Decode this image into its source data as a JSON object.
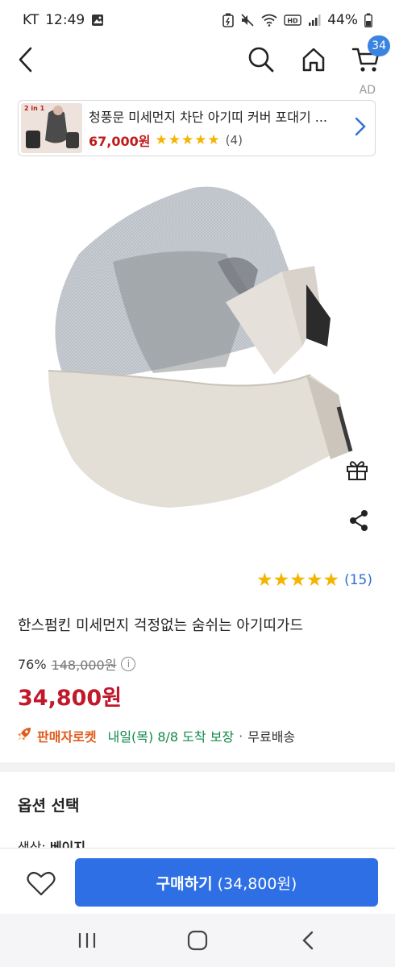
{
  "status_bar": {
    "carrier": "KT",
    "time": "12:49",
    "battery": "44%",
    "icons": [
      "gallery-icon",
      "battery-saver-icon",
      "mute-icon",
      "wifi-icon",
      "hd-voice-icon",
      "signal-icon",
      "battery-icon"
    ]
  },
  "nav": {
    "icons": [
      "back-icon",
      "search-icon",
      "home-icon",
      "cart-icon"
    ],
    "cart_count": "34"
  },
  "ad": {
    "label": "AD",
    "thumb_text": "2 in 1",
    "title": "청풍문 미세먼지 차단 아기띠 커버 포대기 ...",
    "price": "67,000원",
    "stars": "★★★★★",
    "review_count": "(4)"
  },
  "product": {
    "title": "한스펌킨 미세먼지 걱정없는 숨쉬는 아기띠가드",
    "stars": "★★★★★",
    "rating": 5,
    "review_count": "(15)",
    "discount": "76%",
    "original_price": "148,000원",
    "sale_price": "34,800원",
    "side_icons": [
      "gift-icon",
      "share-icon"
    ]
  },
  "delivery": {
    "rocket_label": "판매자로켓",
    "date": "내일(목) 8/8 도착 보장",
    "separator": "·",
    "free_shipping": "무료배송"
  },
  "options": {
    "title": "옵션 선택",
    "color_label": "색상:",
    "color_value": "베이지"
  },
  "bottom_bar": {
    "buy_label": "구매하기",
    "buy_price": "(34,800원)"
  },
  "colors": {
    "accent_blue": "#2f6fe6",
    "price_red": "#c0192b",
    "star_yellow": "#f5b400",
    "delivery_green": "#12884a",
    "rocket_orange": "#e05a1b"
  }
}
